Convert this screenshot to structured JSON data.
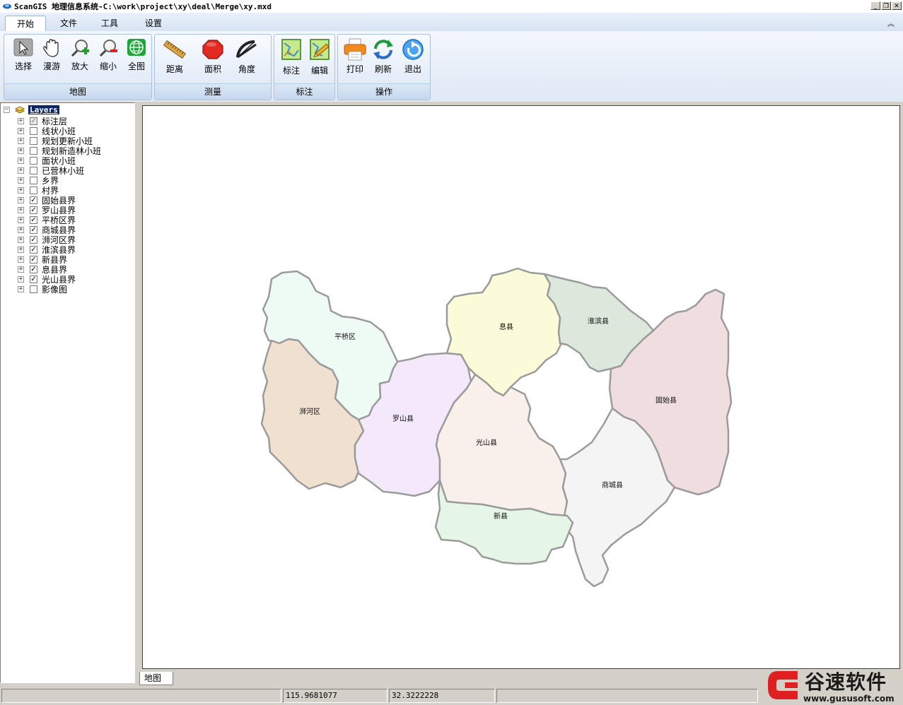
{
  "window": {
    "title": "ScanGIS 地理信息系统-C:\\work\\project\\xy\\deal\\Merge\\xy.mxd",
    "min_glyph": "_",
    "restore_glyph": "❐",
    "close_glyph": "✕"
  },
  "menu": {
    "tabs": [
      {
        "label": "开始",
        "active": true
      },
      {
        "label": "文件",
        "active": false
      },
      {
        "label": "工具",
        "active": false
      },
      {
        "label": "设置",
        "active": false
      }
    ],
    "collapse_glyph": "︽"
  },
  "ribbon": {
    "groups": [
      {
        "label": "地图",
        "buttons": [
          {
            "label": "选择",
            "icon": "select-arrow-icon"
          },
          {
            "label": "漫游",
            "icon": "pan-hand-icon"
          },
          {
            "label": "放大",
            "icon": "zoom-in-icon"
          },
          {
            "label": "缩小",
            "icon": "zoom-out-icon"
          },
          {
            "label": "全图",
            "icon": "globe-icon"
          }
        ]
      },
      {
        "label": "测量",
        "buttons": [
          {
            "label": "距离",
            "icon": "ruler-icon"
          },
          {
            "label": "面积",
            "icon": "area-polygon-icon"
          },
          {
            "label": "角度",
            "icon": "protractor-icon"
          }
        ]
      },
      {
        "label": "标注",
        "buttons": [
          {
            "label": "标注",
            "icon": "annotate-map-icon"
          },
          {
            "label": "编辑",
            "icon": "edit-map-icon"
          }
        ]
      },
      {
        "label": "操作",
        "buttons": [
          {
            "label": "打印",
            "icon": "printer-icon"
          },
          {
            "label": "刷新",
            "icon": "refresh-icon"
          },
          {
            "label": "退出",
            "icon": "exit-icon"
          }
        ]
      }
    ]
  },
  "layers": {
    "root": "Layers",
    "expander": "⊟",
    "items": [
      {
        "name": "标注层",
        "checked": true,
        "grayed": true
      },
      {
        "name": "线状小班",
        "checked": false
      },
      {
        "name": "规划更新小班",
        "checked": false
      },
      {
        "name": "规划新造林小班",
        "checked": false
      },
      {
        "name": "面状小班",
        "checked": false
      },
      {
        "name": "已营林小班",
        "checked": false
      },
      {
        "name": "乡界",
        "checked": false
      },
      {
        "name": "村界",
        "checked": false
      },
      {
        "name": "固始县界",
        "checked": true
      },
      {
        "name": "罗山县界",
        "checked": true
      },
      {
        "name": "平桥区界",
        "checked": true
      },
      {
        "name": "商城县界",
        "checked": true
      },
      {
        "name": "浉河区界",
        "checked": true
      },
      {
        "name": "淮滨县界",
        "checked": true
      },
      {
        "name": "新县界",
        "checked": true
      },
      {
        "name": "息县界",
        "checked": true
      },
      {
        "name": "光山县界",
        "checked": true
      },
      {
        "name": "影像图",
        "checked": false
      }
    ]
  },
  "map": {
    "regions": [
      {
        "name": "平桥区",
        "color": "#eefaf4"
      },
      {
        "name": "浉河区",
        "color": "#f0e0cf"
      },
      {
        "name": "罗山县",
        "color": "#f3e9fb"
      },
      {
        "name": "息县",
        "color": "#fcfbd9"
      },
      {
        "name": "淮滨县",
        "color": "#dde8dc"
      },
      {
        "name": "固始县",
        "color": "#f0dde0"
      },
      {
        "name": "光山县",
        "color": "#f9efeb"
      },
      {
        "name": "商城县",
        "color": "#f3f4f3"
      },
      {
        "name": "新县",
        "color": "#e6f6e6"
      }
    ],
    "border_color": "#9b9b9b",
    "tab_label": "地图"
  },
  "status": {
    "panel1": "",
    "longitude": "115.9681077",
    "latitude": "32.3222228",
    "panel4": ""
  },
  "watermark": {
    "text": "谷速软件",
    "url": "www.gususoft.com",
    "color": "#e02020"
  }
}
